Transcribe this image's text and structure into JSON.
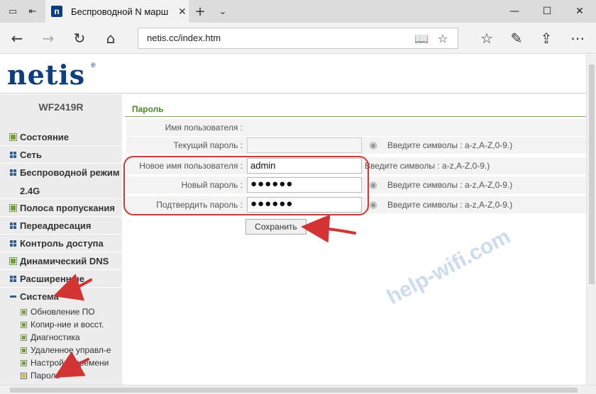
{
  "browser": {
    "tab_title": "Беспроводной N марш",
    "address": "netis.cc/index.htm",
    "tab_favicon": "n"
  },
  "logo": {
    "text": "netis",
    "reg": "®"
  },
  "sidebar": {
    "model": "WF2419R",
    "items": [
      {
        "label": "Состояние",
        "icon": "green-square"
      },
      {
        "label": "Сеть",
        "icon": "grid"
      },
      {
        "label": "Беспроводной режим",
        "icon": "grid"
      },
      {
        "label": "2.4G",
        "icon": "none"
      },
      {
        "label": "Полоса пропускания",
        "icon": "green-square"
      },
      {
        "label": "Переадресация",
        "icon": "grid"
      },
      {
        "label": "Контроль доступа",
        "icon": "grid"
      },
      {
        "label": "Динамический DNS",
        "icon": "green-square"
      },
      {
        "label": "Расширенные",
        "icon": "grid"
      },
      {
        "label": "Система",
        "icon": "minus"
      }
    ],
    "subitems": [
      {
        "label": "Обновление ПО"
      },
      {
        "label": "Копир-ние и восст."
      },
      {
        "label": "Диагностика"
      },
      {
        "label": "Удаленное управл-е"
      },
      {
        "label": "Настройка времени"
      },
      {
        "label": "Пароль"
      }
    ]
  },
  "content": {
    "title": "Пароль",
    "rows": [
      {
        "label": "Имя пользователя :",
        "value": "",
        "hint": ""
      },
      {
        "label": "Текущий пароль :",
        "value": "",
        "hint": "Введите символы : a-z,A-Z,0-9.)"
      },
      {
        "label": "Новое имя пользователя :",
        "value": "admin",
        "hint": "Введите символы : a-z,A-Z,0-9.)"
      },
      {
        "label": "Новый пароль :",
        "value": "●●●●●●",
        "hint": "Введите символы : a-z,A-Z,0-9.)"
      },
      {
        "label": "Подтвердить пароль :",
        "value": "●●●●●●",
        "hint": "Введите символы : a-z,A-Z,0-9.)"
      }
    ],
    "save_label": "Сохранить"
  },
  "watermark": "help-wifi.com",
  "colors": {
    "brand": "#0c3f7f",
    "accent_green": "#6aa22c",
    "annotation_red": "#d33333"
  }
}
